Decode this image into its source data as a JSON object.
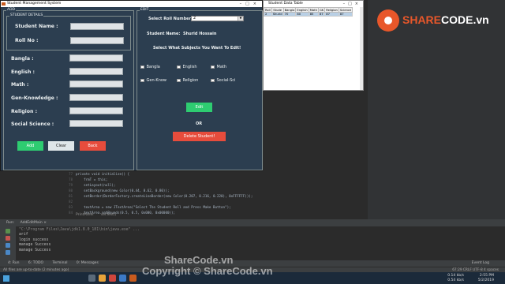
{
  "ide": {
    "line_numbers": [
      "77",
      "78",
      "79",
      "80",
      "81",
      "82",
      "83",
      "84"
    ],
    "code_lines": [
      "private void initialize() {",
      "    frmT = this;",
      "    setLayout(null);",
      "    setBackground(new Color(0.44, 0.62, 0.80));",
      "    setBorder(BorderFactory.createLineBorder(new Color(0.207, 0.216, 0.220), 0xFFFFFF)));",
      "",
      "    textArea = new JTextArea(\"Select The Student Roll and Press Make Button\");",
      "    textArea.setBounds(0.5, 0.5, 0x000, 0x00000));"
    ],
    "editor_tabs": [
      "PrintPanel",
      "setText()"
    ],
    "run": {
      "tabs": [
        "Run:",
        "AddEditMain ×"
      ],
      "console_lines": [
        "\"C:\\Program Files\\Java\\jdk1.8.0_181\\bin\\java.exe\" ...",
        "arif",
        "login success",
        "manage Success",
        "manage Success"
      ]
    },
    "bottom_tabs": [
      "4: Run",
      "6: TODO",
      "Terminal",
      "0: Messages"
    ],
    "event_log": "Event Log",
    "status_left": "All files are up-to-date (2 minutes ago)",
    "status_right": "67:29   CRLF   UTF-8   4 spaces",
    "taskbar": {
      "net_up": "0.14 kb/s",
      "net_down": "0.54 kb/s",
      "time": "2:55 PM",
      "date": "5/2/2019"
    }
  },
  "brand": {
    "name_prefix": "SHARE",
    "name_suffix": "CODE.vn",
    "watermark1": "ShareCode.vn",
    "watermark2": "Copyright © ShareCode.vn"
  },
  "main_window": {
    "title": "Student Management System",
    "add_panel": {
      "label": "ADD",
      "details_label": "STUDENT DETAILS",
      "fields": [
        {
          "label": "Student Name :",
          "value": ""
        },
        {
          "label": "Roll No :",
          "value": ""
        }
      ],
      "subjects": [
        {
          "label": "Bangla :",
          "value": ""
        },
        {
          "label": "English :",
          "value": ""
        },
        {
          "label": "Math :",
          "value": ""
        },
        {
          "label": "Gen-Knowledge :",
          "value": ""
        },
        {
          "label": "Religion :",
          "value": ""
        },
        {
          "label": "Social Science :",
          "value": ""
        }
      ],
      "buttons": {
        "add": "Add",
        "clear": "Clear",
        "back": "Back"
      }
    },
    "edit_panel": {
      "label": "EDIT",
      "roll_label": "Select Roll Number:",
      "roll_value": "2",
      "student_name_label": "Student Name:",
      "student_name_value": "Shurid Hossain",
      "instruction": "Select What Subjects You Want To Edit!",
      "checkboxes": [
        "Bangla",
        "English",
        "Math",
        "Gen-Know",
        "Religion",
        "Social-Sci"
      ],
      "edit_button": "Edit",
      "or_text": "OR",
      "delete_button": "Delete Student!"
    }
  },
  "data_table": {
    "title": "Student Data Table",
    "columns": [
      "Roll",
      "Stude",
      "Bangla",
      "English",
      "Math",
      "GK",
      "Religion",
      "Science"
    ],
    "rows": [
      [
        "2",
        "Shurid",
        "70",
        "80",
        "85",
        "87",
        "87",
        "87"
      ]
    ]
  },
  "colors": {
    "window_bg": "#2c3e50",
    "green": "#2ecc71",
    "red": "#e74c3c",
    "brand_orange": "#e8572a"
  }
}
